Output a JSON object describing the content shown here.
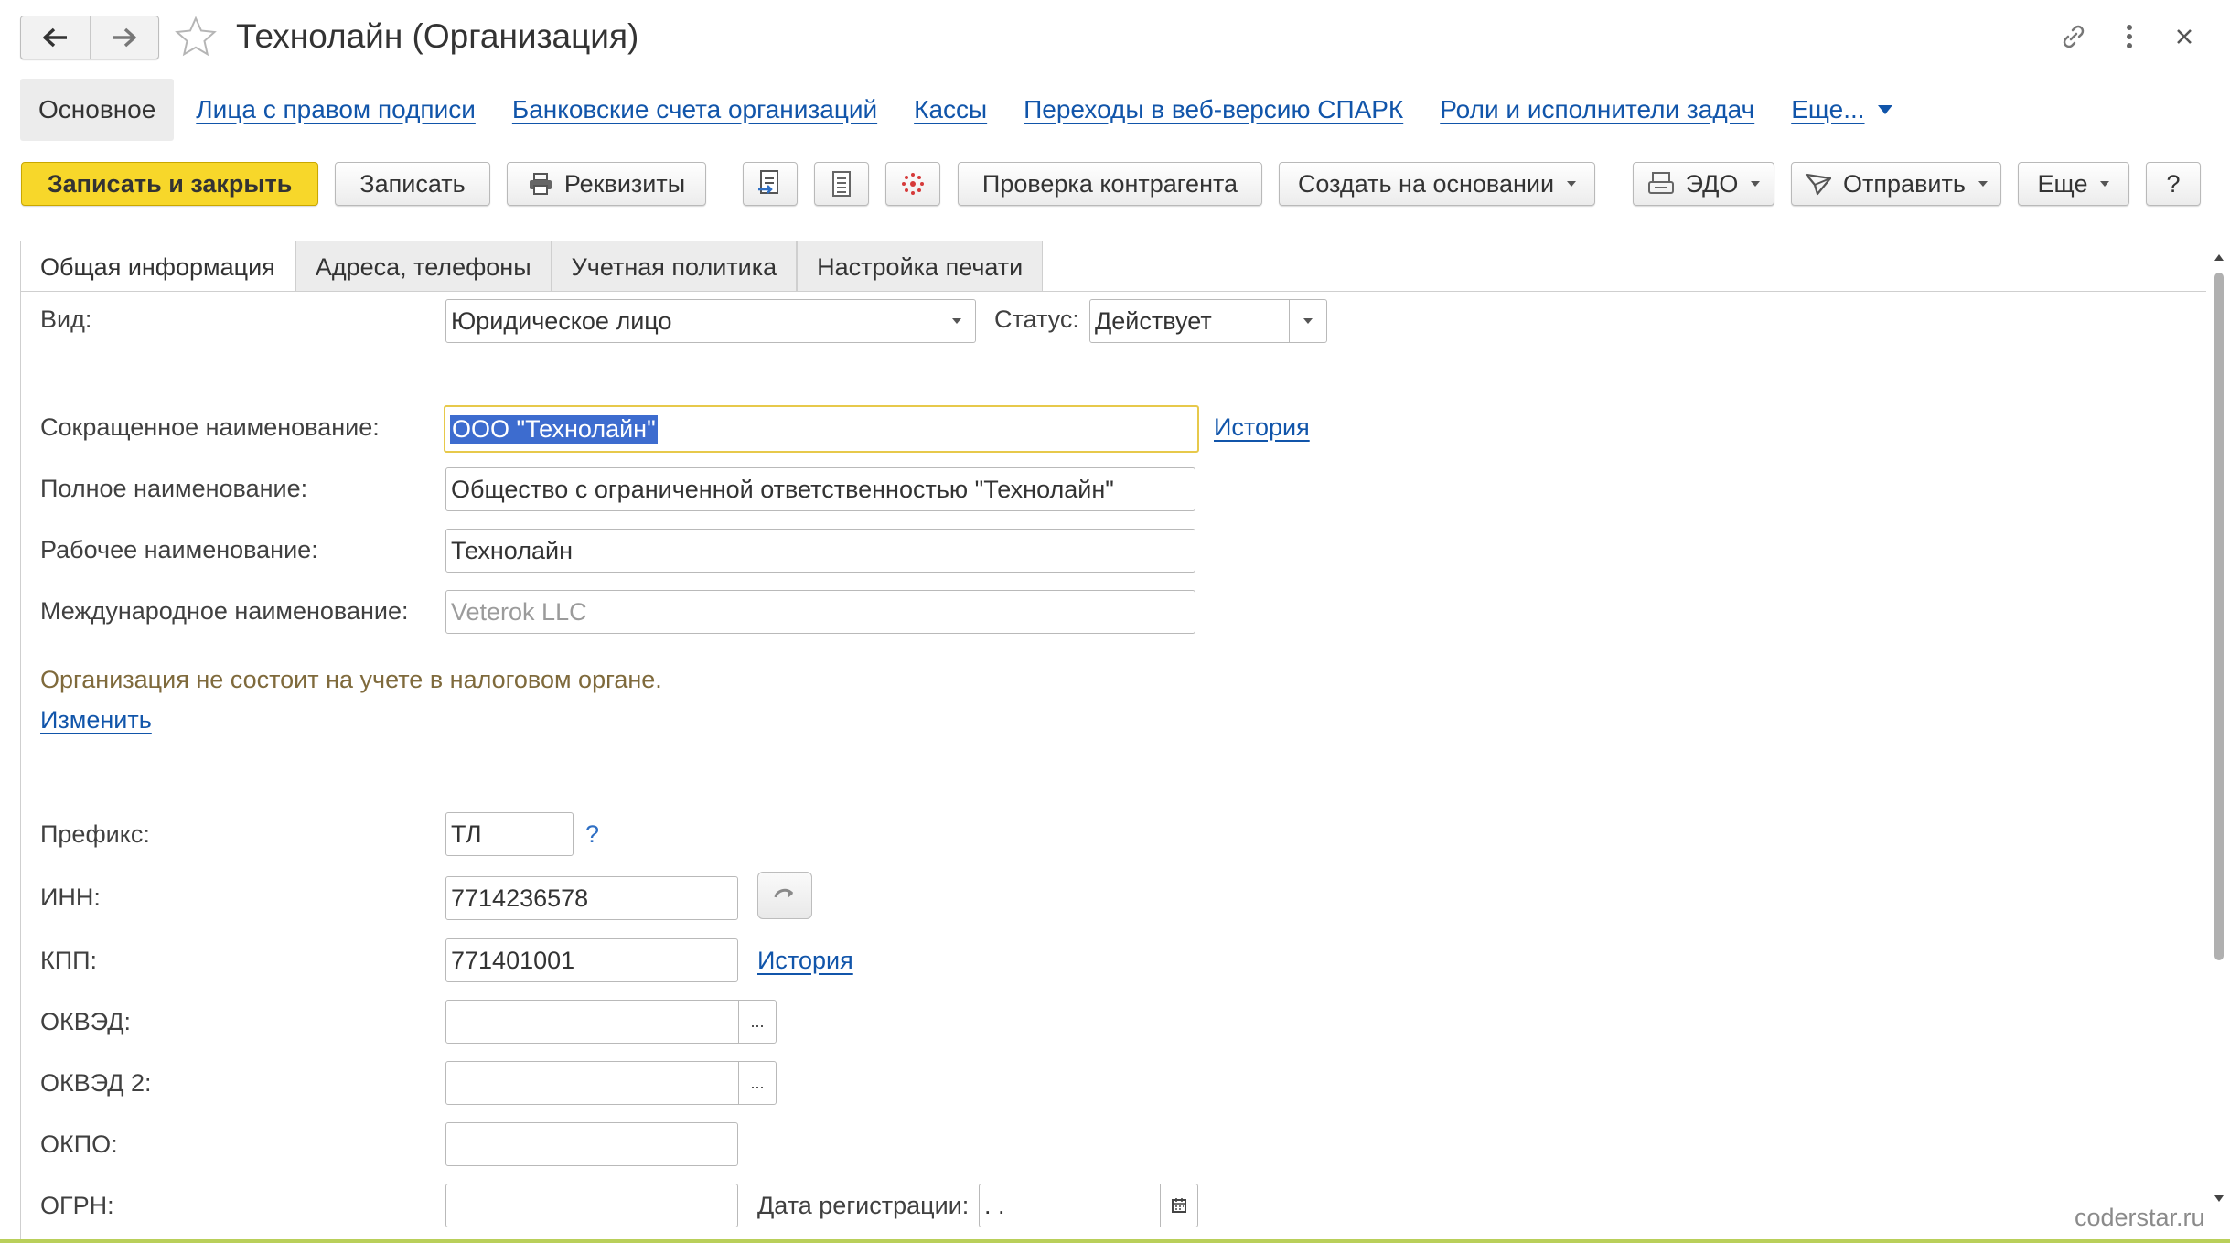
{
  "window": {
    "title": "Технолайн (Организация)"
  },
  "nav": {
    "active": "Основное",
    "links": [
      "Лица с правом подписи",
      "Банковские счета организаций",
      "Кассы",
      "Переходы в веб-версию СПАРК",
      "Роли и исполнители задач"
    ],
    "more": "Еще..."
  },
  "toolbar": {
    "save_close": "Записать и закрыть",
    "save": "Записать",
    "requisites": "Реквизиты",
    "check_counterparty": "Проверка контрагента",
    "create_based": "Создать на основании",
    "edo": "ЭДО",
    "send": "Отправить",
    "more": "Еще",
    "help": "?"
  },
  "tabs": [
    "Общая информация",
    "Адреса, телефоны",
    "Учетная политика",
    "Настройка печати"
  ],
  "form": {
    "vid_label": "Вид:",
    "vid_value": "Юридическое лицо",
    "status_label": "Статус:",
    "status_value": "Действует",
    "short_name_label": "Сокращенное наименование:",
    "short_name_value": "ООО \"Технолайн\"",
    "history": "История",
    "full_name_label": "Полное наименование:",
    "full_name_value": "Общество с ограниченной ответственностью \"Технолайн\"",
    "work_name_label": "Рабочее наименование:",
    "work_name_value": "Технолайн",
    "intl_name_label": "Международное наименование:",
    "intl_name_placeholder": "Veterok LLC",
    "tax_note": "Организация не состоит на учете в налоговом органе.",
    "change_link": "Изменить",
    "prefix_label": "Префикс:",
    "prefix_value": "ТЛ",
    "prefix_help": "?",
    "inn_label": "ИНН:",
    "inn_value": "7714236578",
    "kpp_label": "КПП:",
    "kpp_value": "771401001",
    "kpp_history": "История",
    "okved_label": "ОКВЭД:",
    "okved_value": "",
    "okved2_label": "ОКВЭД 2:",
    "okved2_value": "",
    "okpo_label": "ОКПО:",
    "okpo_value": "",
    "ogrn_label": "ОГРН:",
    "ogrn_value": "",
    "reg_date_label": "Дата регистрации:",
    "reg_date_value": " .  .",
    "dots": "..."
  },
  "watermark": "coderstar.ru",
  "colors": {
    "primary_button": "#f7d72a",
    "link": "#1155aa",
    "focus_border": "#e7c94b",
    "selection": "#3d6ccf",
    "note_text": "#7f6a3c"
  },
  "icons": [
    "arrow-left-icon",
    "arrow-right-icon",
    "star-icon",
    "link-icon",
    "more-vertical-icon",
    "close-icon",
    "printer-icon",
    "document-transfer-icon",
    "list-icon",
    "structure-icon",
    "edo-icon",
    "send-icon",
    "refresh-icon",
    "calendar-icon"
  ]
}
